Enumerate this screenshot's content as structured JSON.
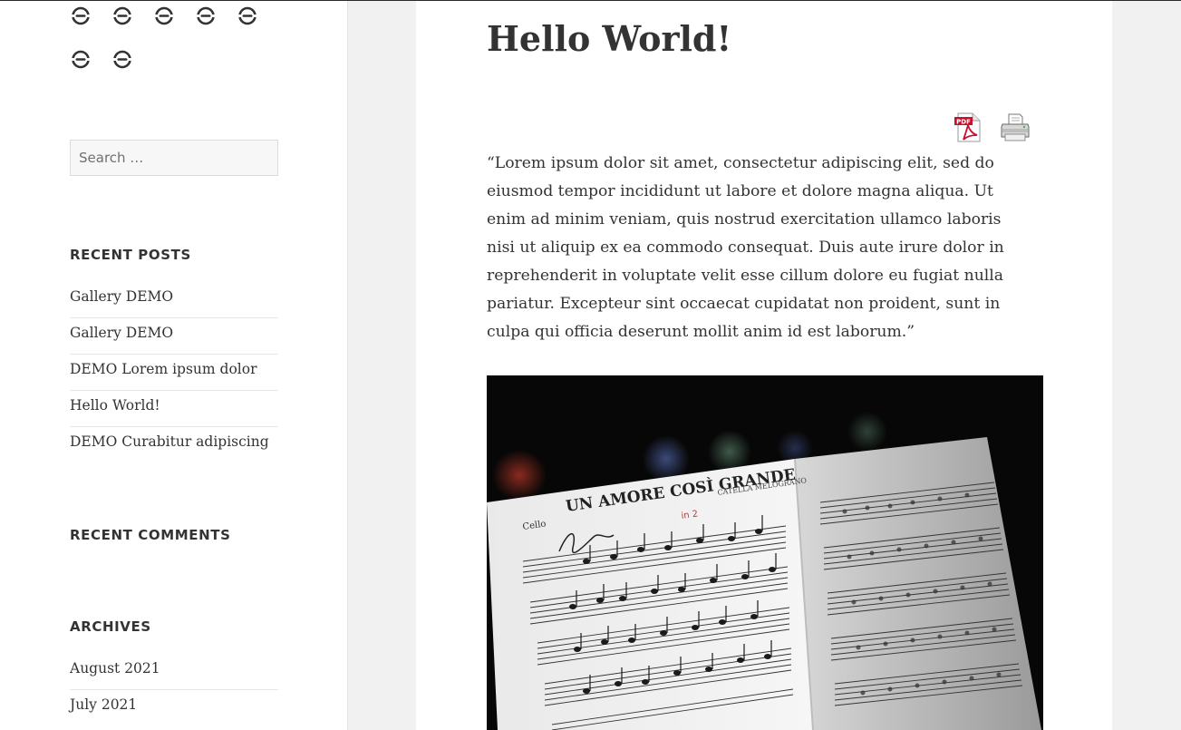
{
  "sidebar": {
    "social_icons": [
      "link-icon",
      "link-icon",
      "link-icon",
      "link-icon",
      "link-icon",
      "link-icon",
      "link-icon"
    ],
    "search": {
      "placeholder": "Search …"
    },
    "recent_posts": {
      "title": "RECENT POSTS",
      "items": [
        "Gallery DEMO",
        "Gallery DEMO",
        "DEMO Lorem ipsum dolor",
        "Hello World!",
        "DEMO Curabitur adipiscing"
      ]
    },
    "recent_comments": {
      "title": "RECENT COMMENTS"
    },
    "archives": {
      "title": "ARCHIVES",
      "items": [
        "August 2021",
        "July 2021"
      ]
    }
  },
  "post": {
    "title": "Hello World!",
    "pdf_icon": "pdf-icon",
    "print_icon": "printer-icon",
    "body": "“Lorem ipsum dolor sit amet, consectetur adipiscing elit, sed do eiusmod tempor incididunt ut labore et dolore magna aliqua. Ut enim ad minim veniam, quis nostrud exercitation ullamco laboris nisi ut aliquip ex ea commodo consequat. Duis aute irure dolor in reprehenderit in voluptate velit esse cillum dolore eu fugiat nulla pariatur. Excepteur sint occaecat cupidatat non proident, sunt in culpa qui officia deserunt mollit anim id est laborum.”",
    "image": {
      "description": "music-sheet-photo",
      "sheet_title": "UN AMORE COSÌ GRANDE",
      "sheet_instrument": "Cello",
      "sheet_composer": "CATELLA MELOGRANO"
    }
  }
}
